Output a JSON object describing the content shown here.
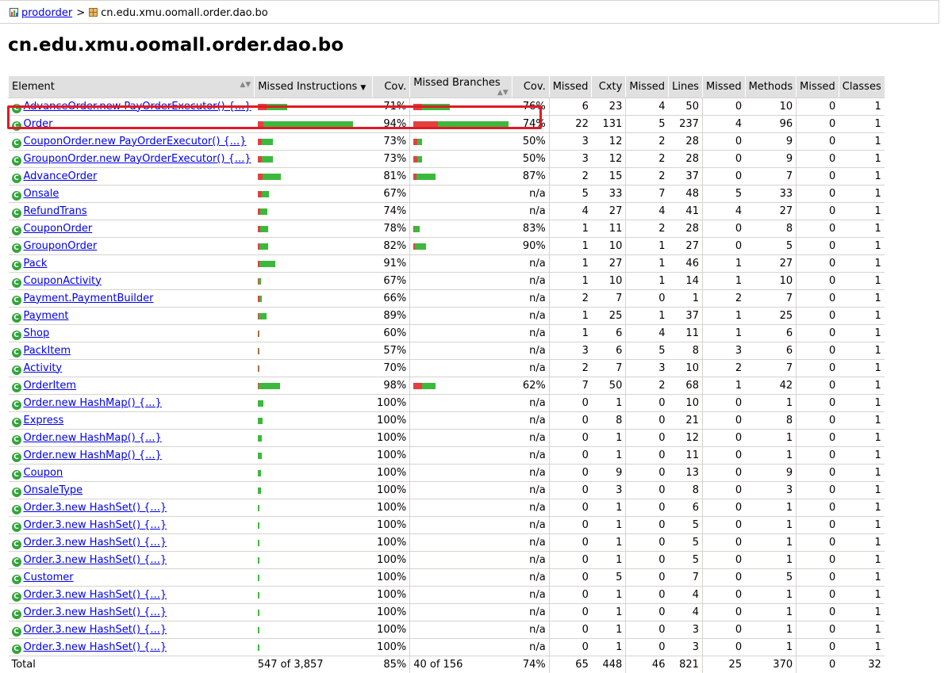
{
  "breadcrumb": {
    "root_label": "prodorder",
    "separator": ">",
    "current": "cn.edu.xmu.oomall.order.dao.bo"
  },
  "page_title": "cn.edu.xmu.oomall.order.dao.bo",
  "headers": {
    "element": "Element",
    "missed_instructions": "Missed Instructions",
    "cov1": "Cov.",
    "missed_branches": "Missed Branches",
    "cov2": "Cov.",
    "missed_cxty": "Missed",
    "cxty": "Cxty",
    "missed_lines": "Missed",
    "lines": "Lines",
    "missed_methods": "Missed",
    "methods": "Methods",
    "missed_classes": "Missed",
    "classes": "Classes"
  },
  "colors": {
    "missed": "#e34040",
    "covered": "#3cb93c",
    "highlight": "#e01a24",
    "link": "#0000ee"
  },
  "rows": [
    {
      "name": "AdvanceOrder.new PayOrderExecutor() {...}",
      "ibar": 0.31,
      "icov": "71%",
      "bbar": 0.38,
      "bcov": "76%",
      "mc": "6",
      "c": "23",
      "ml": "4",
      "l": "50",
      "mm": "0",
      "m": "10",
      "mcl": "0",
      "cl": "1"
    },
    {
      "name": "Order",
      "ibar": 1.0,
      "icov": "94%",
      "bbar": 1.0,
      "bcov": "74%",
      "mc": "22",
      "c": "131",
      "ml": "5",
      "l": "237",
      "mm": "4",
      "m": "96",
      "mcl": "0",
      "cl": "1"
    },
    {
      "name": "CouponOrder.new PayOrderExecutor() {...}",
      "ibar": 0.16,
      "icov": "73%",
      "bbar": 0.09,
      "bcov": "50%",
      "mc": "3",
      "c": "12",
      "ml": "2",
      "l": "28",
      "mm": "0",
      "m": "9",
      "mcl": "0",
      "cl": "1"
    },
    {
      "name": "GrouponOrder.new PayOrderExecutor() {...}",
      "ibar": 0.16,
      "icov": "73%",
      "bbar": 0.09,
      "bcov": "50%",
      "mc": "3",
      "c": "12",
      "ml": "2",
      "l": "28",
      "mm": "0",
      "m": "9",
      "mcl": "0",
      "cl": "1"
    },
    {
      "name": "AdvanceOrder",
      "ibar": 0.24,
      "icov": "81%",
      "bbar": 0.23,
      "bcov": "87%",
      "mc": "2",
      "c": "15",
      "ml": "2",
      "l": "37",
      "mm": "0",
      "m": "7",
      "mcl": "0",
      "cl": "1"
    },
    {
      "name": "Onsale",
      "ibar": 0.12,
      "icov": "67%",
      "bbar": 0,
      "bcov": "n/a",
      "mc": "5",
      "c": "33",
      "ml": "7",
      "l": "48",
      "mm": "5",
      "m": "33",
      "mcl": "0",
      "cl": "1"
    },
    {
      "name": "RefundTrans",
      "ibar": 0.1,
      "icov": "74%",
      "bbar": 0,
      "bcov": "n/a",
      "mc": "4",
      "c": "27",
      "ml": "4",
      "l": "41",
      "mm": "4",
      "m": "27",
      "mcl": "0",
      "cl": "1"
    },
    {
      "name": "CouponOrder",
      "ibar": 0.11,
      "icov": "78%",
      "bbar": 0.07,
      "bcov": "83%",
      "mc": "1",
      "c": "11",
      "ml": "2",
      "l": "28",
      "mm": "0",
      "m": "8",
      "mcl": "0",
      "cl": "1"
    },
    {
      "name": "GrouponOrder",
      "ibar": 0.11,
      "icov": "82%",
      "bbar": 0.13,
      "bcov": "90%",
      "mc": "1",
      "c": "10",
      "ml": "1",
      "l": "27",
      "mm": "0",
      "m": "5",
      "mcl": "0",
      "cl": "1"
    },
    {
      "name": "Pack",
      "ibar": 0.18,
      "icov": "91%",
      "bbar": 0,
      "bcov": "n/a",
      "mc": "1",
      "c": "27",
      "ml": "1",
      "l": "46",
      "mm": "1",
      "m": "27",
      "mcl": "0",
      "cl": "1"
    },
    {
      "name": "CouponActivity",
      "ibar": 0.03,
      "icov": "67%",
      "bbar": 0,
      "bcov": "n/a",
      "mc": "1",
      "c": "10",
      "ml": "1",
      "l": "14",
      "mm": "1",
      "m": "10",
      "mcl": "0",
      "cl": "1"
    },
    {
      "name": "Payment.PaymentBuilder",
      "ibar": 0.04,
      "icov": "66%",
      "bbar": 0,
      "bcov": "n/a",
      "mc": "2",
      "c": "7",
      "ml": "0",
      "l": "1",
      "mm": "2",
      "m": "7",
      "mcl": "0",
      "cl": "1"
    },
    {
      "name": "Payment",
      "ibar": 0.09,
      "icov": "89%",
      "bbar": 0,
      "bcov": "n/a",
      "mc": "1",
      "c": "25",
      "ml": "1",
      "l": "37",
      "mm": "1",
      "m": "25",
      "mcl": "0",
      "cl": "1"
    },
    {
      "name": "Shop",
      "ibar": 0.02,
      "icov": "60%",
      "bbar": 0,
      "bcov": "n/a",
      "mc": "1",
      "c": "6",
      "ml": "4",
      "l": "11",
      "mm": "1",
      "m": "6",
      "mcl": "0",
      "cl": "1"
    },
    {
      "name": "PackItem",
      "ibar": 0.02,
      "icov": "57%",
      "bbar": 0,
      "bcov": "n/a",
      "mc": "3",
      "c": "6",
      "ml": "5",
      "l": "8",
      "mm": "3",
      "m": "6",
      "mcl": "0",
      "cl": "1"
    },
    {
      "name": "Activity",
      "ibar": 0.01,
      "icov": "70%",
      "bbar": 0,
      "bcov": "n/a",
      "mc": "2",
      "c": "7",
      "ml": "3",
      "l": "10",
      "mm": "2",
      "m": "7",
      "mcl": "0",
      "cl": "1"
    },
    {
      "name": "OrderItem",
      "ibar": 0.23,
      "icov": "98%",
      "bbar": 0.23,
      "bcov": "62%",
      "mc": "7",
      "c": "50",
      "ml": "2",
      "l": "68",
      "mm": "1",
      "m": "42",
      "mcl": "0",
      "cl": "1"
    },
    {
      "name": "Order.new HashMap() {...}",
      "ibar": 0.06,
      "icov": "100%",
      "bbar": 0,
      "bcov": "n/a",
      "mc": "0",
      "c": "1",
      "ml": "0",
      "l": "10",
      "mm": "0",
      "m": "1",
      "mcl": "0",
      "cl": "1"
    },
    {
      "name": "Express",
      "ibar": 0.05,
      "icov": "100%",
      "bbar": 0,
      "bcov": "n/a",
      "mc": "0",
      "c": "8",
      "ml": "0",
      "l": "21",
      "mm": "0",
      "m": "8",
      "mcl": "0",
      "cl": "1"
    },
    {
      "name": "Order.new HashMap() {...}",
      "ibar": 0.04,
      "icov": "100%",
      "bbar": 0,
      "bcov": "n/a",
      "mc": "0",
      "c": "1",
      "ml": "0",
      "l": "12",
      "mm": "0",
      "m": "1",
      "mcl": "0",
      "cl": "1"
    },
    {
      "name": "Order.new HashMap() {...}",
      "ibar": 0.04,
      "icov": "100%",
      "bbar": 0,
      "bcov": "n/a",
      "mc": "0",
      "c": "1",
      "ml": "0",
      "l": "11",
      "mm": "0",
      "m": "1",
      "mcl": "0",
      "cl": "1"
    },
    {
      "name": "Coupon",
      "ibar": 0.03,
      "icov": "100%",
      "bbar": 0,
      "bcov": "n/a",
      "mc": "0",
      "c": "9",
      "ml": "0",
      "l": "13",
      "mm": "0",
      "m": "9",
      "mcl": "0",
      "cl": "1"
    },
    {
      "name": "OnsaleType",
      "ibar": 0.03,
      "icov": "100%",
      "bbar": 0,
      "bcov": "n/a",
      "mc": "0",
      "c": "3",
      "ml": "0",
      "l": "8",
      "mm": "0",
      "m": "3",
      "mcl": "0",
      "cl": "1"
    },
    {
      "name": "Order.3.new HashSet() {...}",
      "ibar": 0.02,
      "icov": "100%",
      "bbar": 0,
      "bcov": "n/a",
      "mc": "0",
      "c": "1",
      "ml": "0",
      "l": "6",
      "mm": "0",
      "m": "1",
      "mcl": "0",
      "cl": "1"
    },
    {
      "name": "Order.3.new HashSet() {...}",
      "ibar": 0.015,
      "icov": "100%",
      "bbar": 0,
      "bcov": "n/a",
      "mc": "0",
      "c": "1",
      "ml": "0",
      "l": "5",
      "mm": "0",
      "m": "1",
      "mcl": "0",
      "cl": "1"
    },
    {
      "name": "Order.3.new HashSet() {...}",
      "ibar": 0.015,
      "icov": "100%",
      "bbar": 0,
      "bcov": "n/a",
      "mc": "0",
      "c": "1",
      "ml": "0",
      "l": "5",
      "mm": "0",
      "m": "1",
      "mcl": "0",
      "cl": "1"
    },
    {
      "name": "Order.3.new HashSet() {...}",
      "ibar": 0.015,
      "icov": "100%",
      "bbar": 0,
      "bcov": "n/a",
      "mc": "0",
      "c": "1",
      "ml": "0",
      "l": "5",
      "mm": "0",
      "m": "1",
      "mcl": "0",
      "cl": "1"
    },
    {
      "name": "Customer",
      "ibar": 0.015,
      "icov": "100%",
      "bbar": 0,
      "bcov": "n/a",
      "mc": "0",
      "c": "5",
      "ml": "0",
      "l": "7",
      "mm": "0",
      "m": "5",
      "mcl": "0",
      "cl": "1"
    },
    {
      "name": "Order.3.new HashSet() {...}",
      "ibar": 0.012,
      "icov": "100%",
      "bbar": 0,
      "bcov": "n/a",
      "mc": "0",
      "c": "1",
      "ml": "0",
      "l": "4",
      "mm": "0",
      "m": "1",
      "mcl": "0",
      "cl": "1"
    },
    {
      "name": "Order.3.new HashSet() {...}",
      "ibar": 0.012,
      "icov": "100%",
      "bbar": 0,
      "bcov": "n/a",
      "mc": "0",
      "c": "1",
      "ml": "0",
      "l": "4",
      "mm": "0",
      "m": "1",
      "mcl": "0",
      "cl": "1"
    },
    {
      "name": "Order.3.new HashSet() {...}",
      "ibar": 0.01,
      "icov": "100%",
      "bbar": 0,
      "bcov": "n/a",
      "mc": "0",
      "c": "1",
      "ml": "0",
      "l": "3",
      "mm": "0",
      "m": "1",
      "mcl": "0",
      "cl": "1"
    },
    {
      "name": "Order.3.new HashSet() {...}",
      "ibar": 0.01,
      "icov": "100%",
      "bbar": 0,
      "bcov": "n/a",
      "mc": "0",
      "c": "1",
      "ml": "0",
      "l": "3",
      "mm": "0",
      "m": "1",
      "mcl": "0",
      "cl": "1"
    }
  ],
  "total": {
    "label": "Total",
    "instructions": "547 of 3,857",
    "icov": "85%",
    "branches": "40 of 156",
    "bcov": "74%",
    "mc": "65",
    "c": "448",
    "ml": "46",
    "l": "821",
    "mm": "25",
    "m": "370",
    "mcl": "0",
    "cl": "32"
  }
}
